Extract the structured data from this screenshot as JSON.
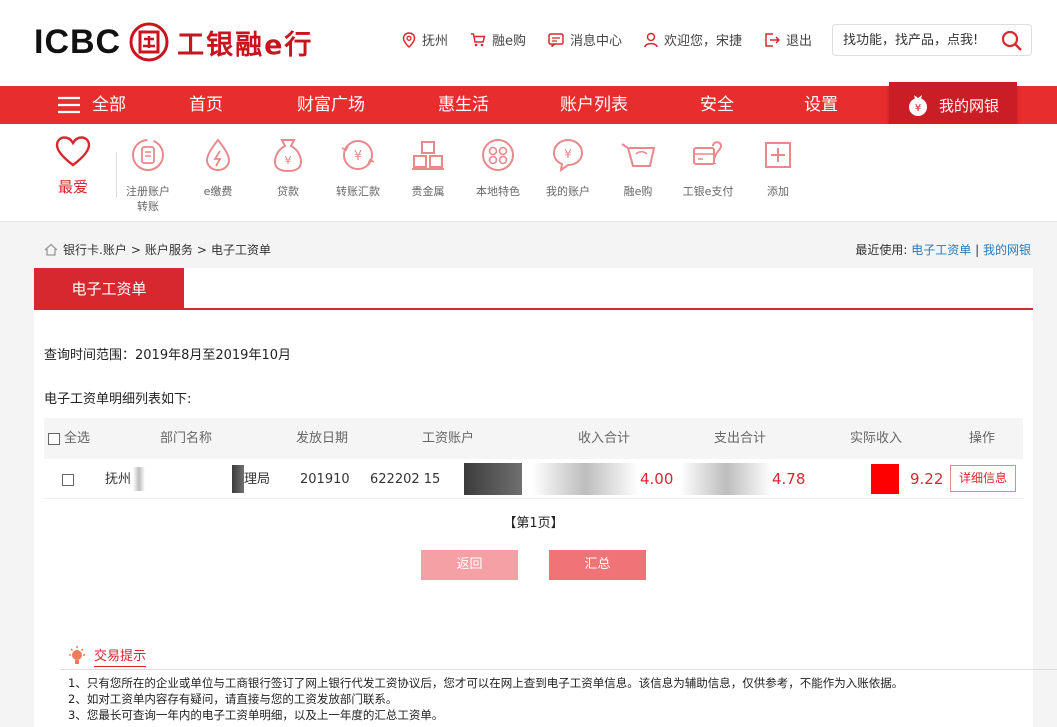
{
  "header": {
    "logo_text": "ICBC",
    "logo_cn": "工银融e行",
    "links": [
      {
        "icon": "location-icon",
        "label": "抚州"
      },
      {
        "icon": "cart-icon",
        "label": "融e购"
      },
      {
        "icon": "message-icon",
        "label": "消息中心"
      },
      {
        "icon": "user-icon",
        "label": "欢迎您，宋捷"
      },
      {
        "icon": "logout-icon",
        "label": "退出"
      }
    ],
    "search_placeholder": "找功能，找产品，点我!"
  },
  "nav": {
    "items": [
      "全部",
      "首页",
      "财富广场",
      "惠生活",
      "账户列表",
      "安全",
      "设置"
    ],
    "mybank": "我的网银"
  },
  "quick": {
    "favorite": "最爱",
    "items": [
      {
        "icon": "register-account-icon",
        "label": "注册账户\n转账"
      },
      {
        "icon": "e-payment-icon",
        "label": "e缴费"
      },
      {
        "icon": "loan-icon",
        "label": "贷款"
      },
      {
        "icon": "transfer-icon",
        "label": "转账汇款"
      },
      {
        "icon": "precious-metal-icon",
        "label": "贵金属"
      },
      {
        "icon": "local-feature-icon",
        "label": "本地特色"
      },
      {
        "icon": "my-account-icon",
        "label": "我的账户"
      },
      {
        "icon": "e-shop-icon",
        "label": "融e购"
      },
      {
        "icon": "e-pay-icon",
        "label": "工银e支付"
      },
      {
        "icon": "add-icon",
        "label": "添加"
      }
    ]
  },
  "breadcrumb": [
    "银行卡.账户",
    ">",
    "账户服务",
    ">",
    "电子工资单"
  ],
  "recent": {
    "label": "最近使用:",
    "link1": "电子工资单",
    "sep": "|",
    "link2": "我的网银"
  },
  "panel": {
    "tab": "电子工资单",
    "query_range": "查询时间范围：2019年8月至2019年10月",
    "list_label": "电子工资单明细列表如下:",
    "columns": [
      "全选",
      "部门名称",
      "发放日期",
      "工资账户",
      "收入合计",
      "支出合计",
      "实际收入",
      "操作"
    ],
    "rows": [
      {
        "dept_start": "抚州",
        "dept_end": "理局",
        "date": "201910",
        "account": "622202 15",
        "income": "4.00",
        "expense": "4.78",
        "actual": "9.22",
        "action": "详细信息"
      }
    ],
    "page": "【第1页】",
    "back_button": "返回",
    "summary_button": "汇总"
  },
  "tips": {
    "title": "交易提示",
    "lines": [
      "1、只有您所在的企业或单位与工商银行签订了网上银行代发工资协议后，您才可以在网上查到电子工资单信息。该信息为辅助信息，仅供参考，不能作为入账依据。",
      "2、如对工资单内容存有疑问，请直接与您的工资发放部门联系。",
      "3、您最长可查询一年内的电子工资单明细，以及上一年度的汇总工资单。"
    ]
  },
  "colors": {
    "brand_red": "#e72d2e",
    "dark_red": "#c91e25",
    "link_blue": "#2a7ab8"
  }
}
